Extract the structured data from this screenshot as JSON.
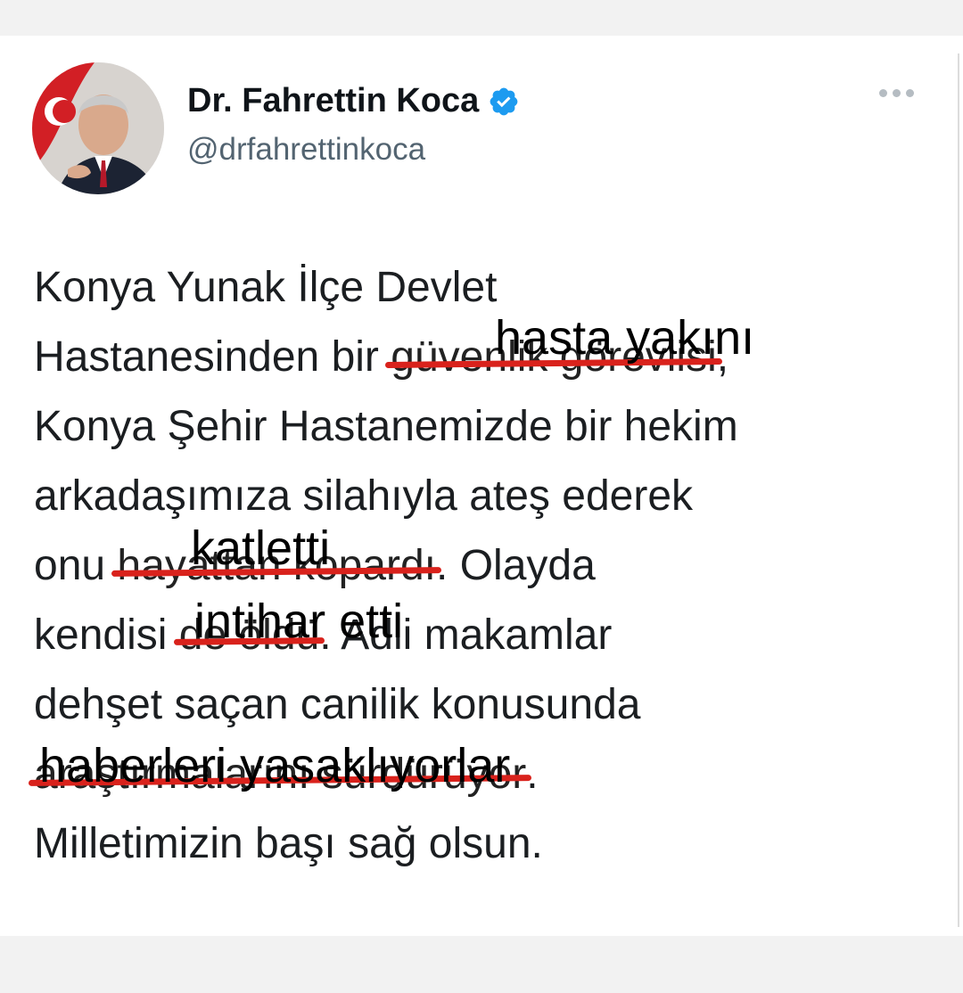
{
  "author": {
    "name": "Dr. Fahrettin Koca",
    "handle": "@drfahrettinkoca",
    "verified": true,
    "avatar_icon": "profile-photo-icon"
  },
  "more_icon": "more-options-icon",
  "tweet_lines": {
    "l1": "Konya Yunak İlçe Devlet",
    "l2_a": "Hastanesinden bir ",
    "l2_struck": "güvenlik görevlisi",
    "l2_b": ",",
    "l3": "Konya Şehir Hastanemizde bir hekim",
    "l4": "arkadaşımıza silahıyla ateş ederek",
    "l5_a": "onu ",
    "l5_struck": "hayattan kopardı",
    "l5_b": ". Olayda",
    "l6_a": "kendisi ",
    "l6_struck": "de öldü",
    "l6_b": ". Adli makamlar",
    "l7": "dehşet saçan canilik konusunda",
    "l8_struck": "araştırmalarını sürdürüyor",
    "l8_b": ".",
    "l9": "Milletimizin başı sağ olsun."
  },
  "overlays": {
    "o1": "hasta yakını",
    "o2": "katletti",
    "o3": "intihar etti",
    "o4": "haberleri yasaklıyorlar"
  },
  "colors": {
    "strike": "#d9221c",
    "verified": "#1d9bf0",
    "name": "#0f1419",
    "handle": "#536471"
  }
}
